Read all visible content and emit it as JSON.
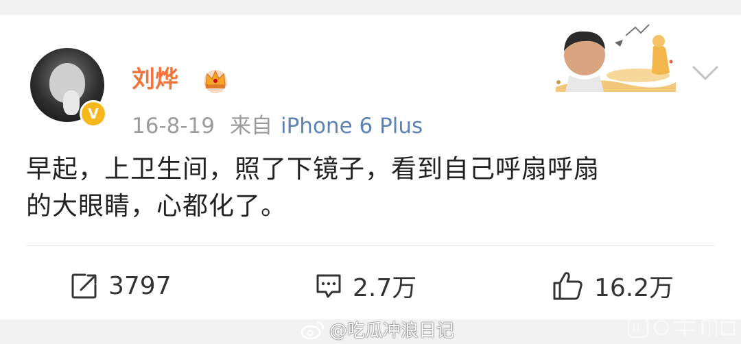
{
  "post": {
    "username": "刘烨",
    "date": "16-8-19",
    "source_prefix": "来自",
    "device": "iPhone 6 Plus",
    "text_line1": "早起，上卫生间，照了下镜子，看到自己呼扇呼扇",
    "text_line2": "的大眼睛，心都化了。"
  },
  "actions": {
    "repost_count": "3797",
    "comment_count": "2.7万",
    "like_count": "16.2万"
  },
  "watermark": {
    "text": "@吃瓜冲浪日记"
  },
  "colors": {
    "username": "#f1753b",
    "device_link": "#5d82b3",
    "verified_badge": "#f6b81c",
    "meta_gray": "#9b9b9b"
  },
  "icons": {
    "verified": "verified-v-badge",
    "member": "crown-icon",
    "dropdown": "chevron-down-icon",
    "repost": "repost-icon",
    "comment": "comment-icon",
    "like": "thumbs-up-icon"
  }
}
